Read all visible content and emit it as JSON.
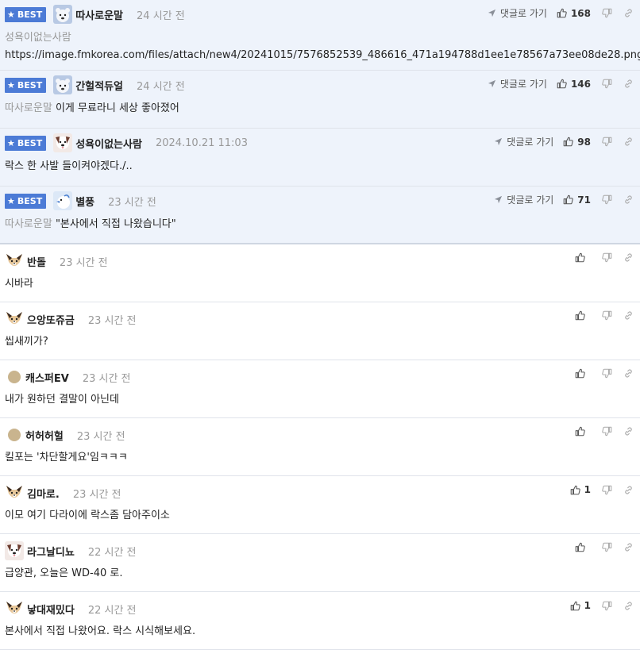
{
  "labels": {
    "best": "BEST",
    "reply_link": "댓글로 가기"
  },
  "best_comments": [
    {
      "nick": "따사로운말",
      "time": "24 시간 전",
      "likes": "168",
      "avatar": "icebear",
      "quote": "성욕이없는사람",
      "text": "",
      "url": "https://image.fmkorea.com/files/attach/new4/20241015/7576852539_486616_471a194788d1ee1e78567a73ee08de28.png"
    },
    {
      "nick": "간헐적듀얼",
      "time": "24 시간 전",
      "likes": "146",
      "avatar": "icebear",
      "quote": "따사로운말",
      "text": "이게 무료라니 세상 좋아졌어",
      "url": ""
    },
    {
      "nick": "성욕이없는사람",
      "time": "2024.10.21 11:03",
      "likes": "98",
      "avatar": "dog",
      "quote": "",
      "text": "락스 한 사발 들이켜야겠다./..",
      "url": ""
    },
    {
      "nick": "별풍",
      "time": "23 시간 전",
      "likes": "71",
      "avatar": "bird",
      "quote": "따사로운말",
      "text": "\"본사에서 직접 나왔습니다\"",
      "url": ""
    }
  ],
  "comments": [
    {
      "nick": "반돌",
      "time": "23 시간 전",
      "likes": "",
      "avatar": "fox",
      "text": "시바라"
    },
    {
      "nick": "으앙또쥬금",
      "time": "23 시간 전",
      "likes": "",
      "avatar": "fox",
      "text": "씹새끼가?"
    },
    {
      "nick": "캐스퍼EV",
      "time": "23 시간 전",
      "likes": "",
      "avatar": "dot",
      "text": "내가 원하던 결말이 아닌데"
    },
    {
      "nick": "허허허헐",
      "time": "23 시간 전",
      "likes": "",
      "avatar": "dot",
      "text": "킬포는 '차단할게요'임ㅋㅋㅋ"
    },
    {
      "nick": "김마로.",
      "time": "23 시간 전",
      "likes": "1",
      "avatar": "fox",
      "text": "이모 여기 다라이에 락스좀 담아주이소"
    },
    {
      "nick": "라그날디뇨",
      "time": "22 시간 전",
      "likes": "",
      "avatar": "dog",
      "text": "급양관, 오늘은 WD-40 로."
    },
    {
      "nick": "낳대재밌다",
      "time": "22 시간 전",
      "likes": "1",
      "avatar": "fox",
      "text": "본사에서 직접 나왔어요. 락스 시식해보세요."
    }
  ],
  "colors": {
    "best_bg": "#eef3fb",
    "badge": "#4c7bd6",
    "meta": "#999999"
  }
}
